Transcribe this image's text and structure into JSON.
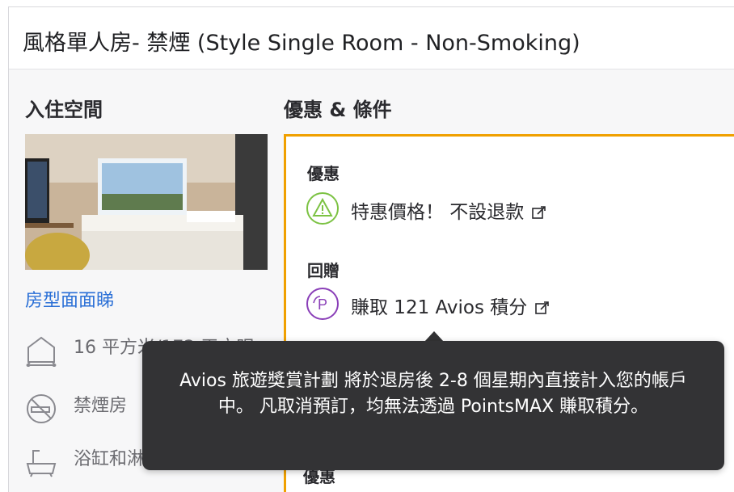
{
  "room": {
    "title": "風格單人房- 禁煙 (Style Single Room - Non-Smoking)"
  },
  "left": {
    "heading": "入住空間",
    "room_link": "房型面面睇",
    "features": [
      {
        "icon": "house-size-icon",
        "text": "16 平方米/172 平方呎"
      },
      {
        "icon": "no-smoking-icon",
        "text": "禁煙房"
      },
      {
        "icon": "bathtub-icon",
        "text": "浴缸和淋浴"
      }
    ]
  },
  "right": {
    "heading": "優惠 & 條件",
    "offer_label": "優惠",
    "offer_text": "特惠價格！ 不設退款",
    "reward_label": "回贈",
    "reward_text": "賺取 121 Avios 積分",
    "bottom_label": "優惠"
  },
  "tooltip": {
    "text": "Avios 旅遊獎賞計劃 將於退房後 2-8 個星期內直接計入您的帳戶中。 凡取消預訂，均無法透過 PointsMAX 賺取積分。"
  },
  "colors": {
    "accent_orange": "#f0a000",
    "link_blue": "#2a6fd6",
    "warning_green": "#7cc243",
    "avios_purple": "#8a3fb8",
    "tooltip_bg": "#333335"
  }
}
